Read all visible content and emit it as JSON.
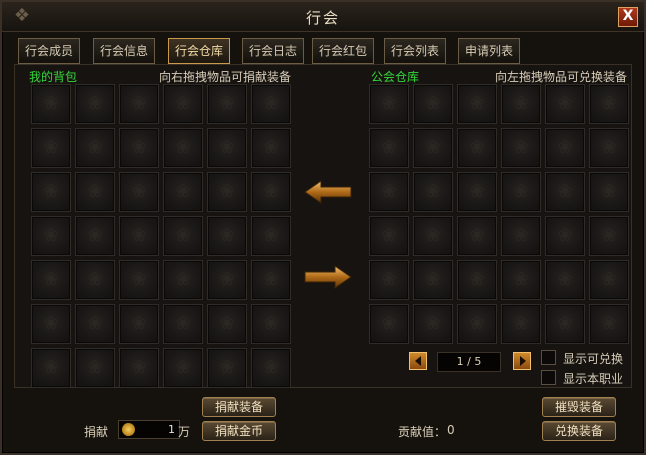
{
  "window": {
    "title": "行会",
    "close_label": "X"
  },
  "tabs": [
    {
      "label": "行会成员",
      "active": false
    },
    {
      "label": "行会信息",
      "active": false
    },
    {
      "label": "行会仓库",
      "active": true
    },
    {
      "label": "行会日志",
      "active": false
    },
    {
      "label": "行会红包",
      "active": false
    },
    {
      "label": "行会列表",
      "active": false
    },
    {
      "label": "申请列表",
      "active": false
    }
  ],
  "left_panel": {
    "title": "我的背包",
    "hint": "向右拖拽物品可捐献装备",
    "rows": 7,
    "cols": 6
  },
  "right_panel": {
    "title": "公会仓库",
    "hint": "向左拖拽物品可兑换装备",
    "rows": 6,
    "cols": 6
  },
  "arrows": {
    "left_icon": "arrow-left-icon",
    "right_icon": "arrow-right-icon"
  },
  "pager": {
    "current": 1,
    "total": 5,
    "text": "1 / 5"
  },
  "checkboxes": [
    {
      "label": "显示可兑换",
      "checked": false
    },
    {
      "label": "显示本职业",
      "checked": false
    }
  ],
  "donate": {
    "label": "捐献",
    "amount": "1",
    "unit": "万",
    "donate_equipment_button": "捐献装备",
    "donate_gold_button": "捐献金币"
  },
  "contribution": {
    "label": "贡献值：",
    "value": "0"
  },
  "actions": {
    "destroy_button": "摧毁装备",
    "exchange_button": "兑换装备"
  },
  "colors": {
    "accent": "#c99a4a",
    "green": "#35d83a",
    "close": "#b03a1c"
  }
}
